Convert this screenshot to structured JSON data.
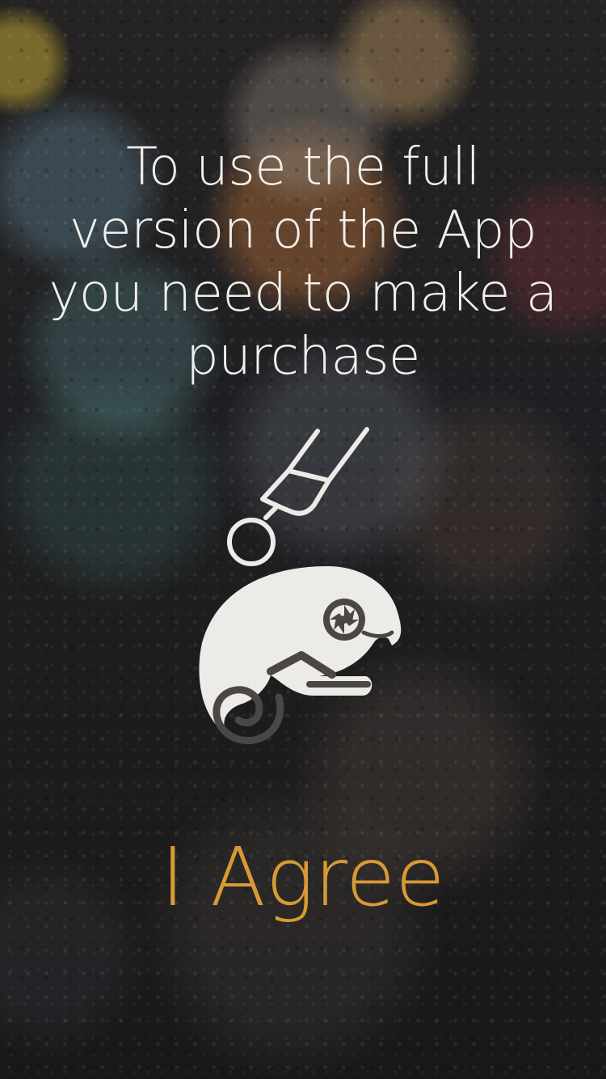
{
  "screen": {
    "message": "To use the full version of the App you need to make a purchase",
    "agree_label": "I Agree"
  },
  "illustration": {
    "icons": [
      "pen-nib-icon",
      "chameleon-camera-logo",
      "camera-aperture-icon"
    ]
  },
  "colors": {
    "text": "#f1efea",
    "accent": "#d89a35",
    "icon": "#ecebe7"
  }
}
